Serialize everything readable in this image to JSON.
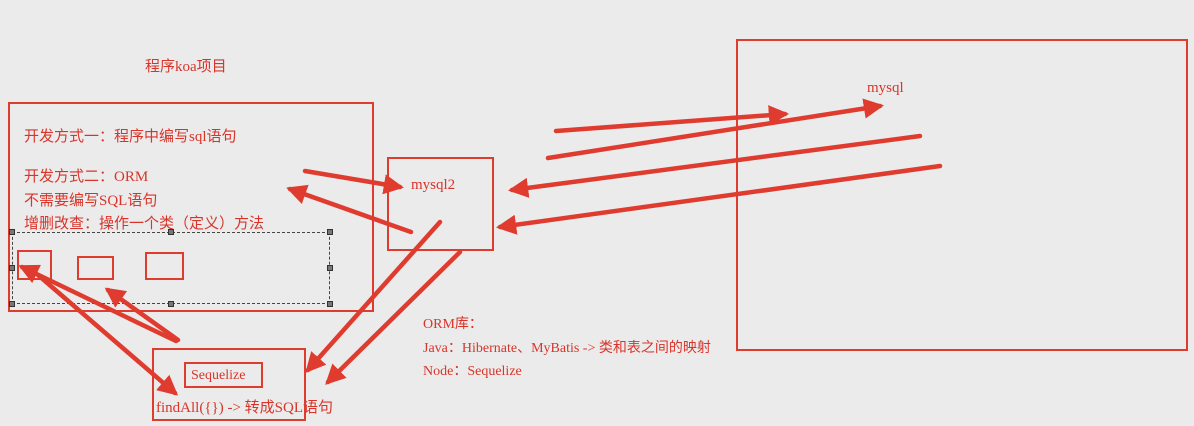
{
  "title": "程序koa项目",
  "koa_box": {
    "way1": "开发方式一：程序中编写sql语句",
    "way2": "开发方式二：ORM",
    "no_sql": "不需要编写SQL语句",
    "crud": "增删改查：操作一个类（定义）方法"
  },
  "mysql2_box": {
    "label": "mysql2"
  },
  "mysql_box": {
    "label": "mysql"
  },
  "sequelize_box": {
    "label": "Sequelize",
    "findall": "findAll({}) -> 转成SQL语句"
  },
  "orm_notes": {
    "heading": "ORM库：",
    "java": "Java：Hibernate、MyBatis -> 类和表之间的映射",
    "node": "Node：Sequelize"
  },
  "colors": {
    "stroke": "#df3b2f",
    "text": "#d9342a",
    "background": "#ebebeb"
  }
}
